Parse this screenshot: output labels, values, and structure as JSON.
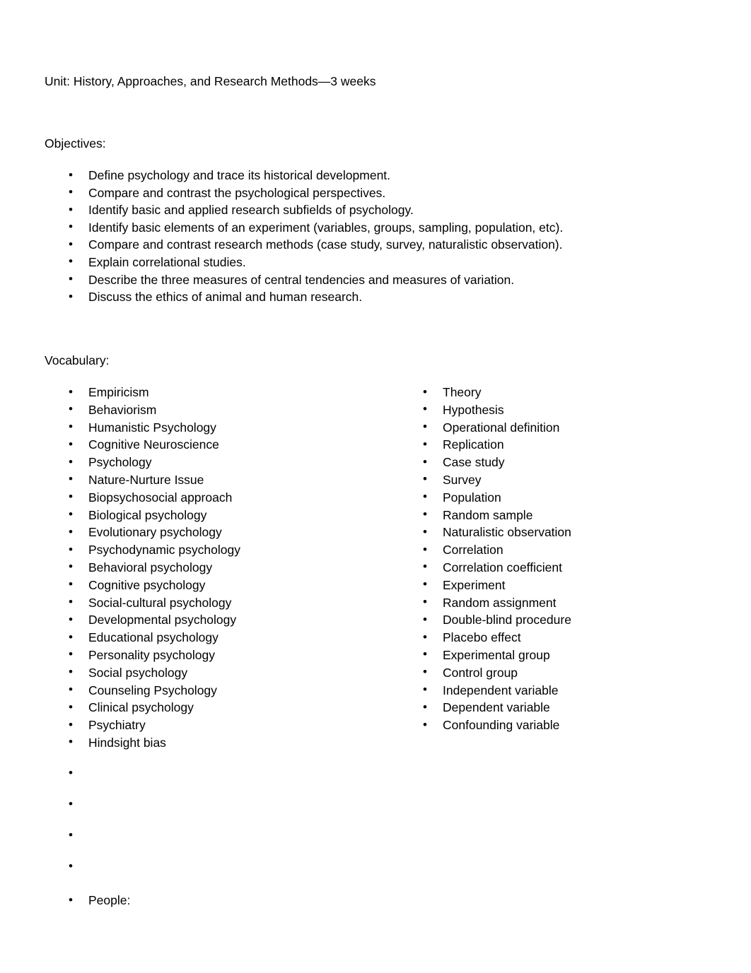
{
  "document": {
    "title": "Unit: History, Approaches, and Research Methods—3 weeks"
  },
  "objectives": {
    "heading": "Objectives:",
    "items": [
      "Define psychology and trace its historical development.",
      "Compare and contrast the psychological perspectives.",
      "Identify basic and applied research subfields of psychology.",
      "Identify basic elements of an experiment (variables, groups, sampling, population, etc).",
      "Compare and contrast research methods (case study, survey, naturalistic observation).",
      "Explain correlational studies.",
      "Describe the three measures of central tendencies and measures of variation.",
      "Discuss the ethics of animal and human research."
    ]
  },
  "vocabulary": {
    "heading": "Vocabulary:",
    "left_column": [
      "Empiricism",
      "Behaviorism",
      "Humanistic Psychology",
      "Cognitive Neuroscience",
      "Psychology",
      "Nature-Nurture Issue",
      "Biopsychosocial approach",
      "Biological psychology",
      "Evolutionary psychology",
      "Psychodynamic psychology",
      "Behavioral psychology",
      "Cognitive psychology",
      "Social-cultural psychology",
      "Developmental psychology",
      "Educational psychology",
      "Personality psychology",
      "Social psychology",
      "Counseling Psychology",
      "Clinical psychology",
      "Psychiatry",
      "Hindsight bias"
    ],
    "right_column": [
      "Theory",
      "Hypothesis",
      "Operational definition",
      "Replication",
      "Case study",
      "Survey",
      "Population",
      "Random sample",
      "Naturalistic observation",
      "Correlation",
      "Correlation coefficient",
      "Experiment",
      "Random assignment",
      "Double-blind procedure",
      "Placebo effect",
      "Experimental group",
      "Control group",
      "Independent variable",
      "Dependent variable",
      "Confounding variable"
    ]
  },
  "empty_bullets": [
    "",
    "",
    "",
    ""
  ],
  "people": {
    "items": [
      "People:"
    ]
  },
  "colors": {
    "text": "#000000",
    "background": "#ffffff"
  }
}
